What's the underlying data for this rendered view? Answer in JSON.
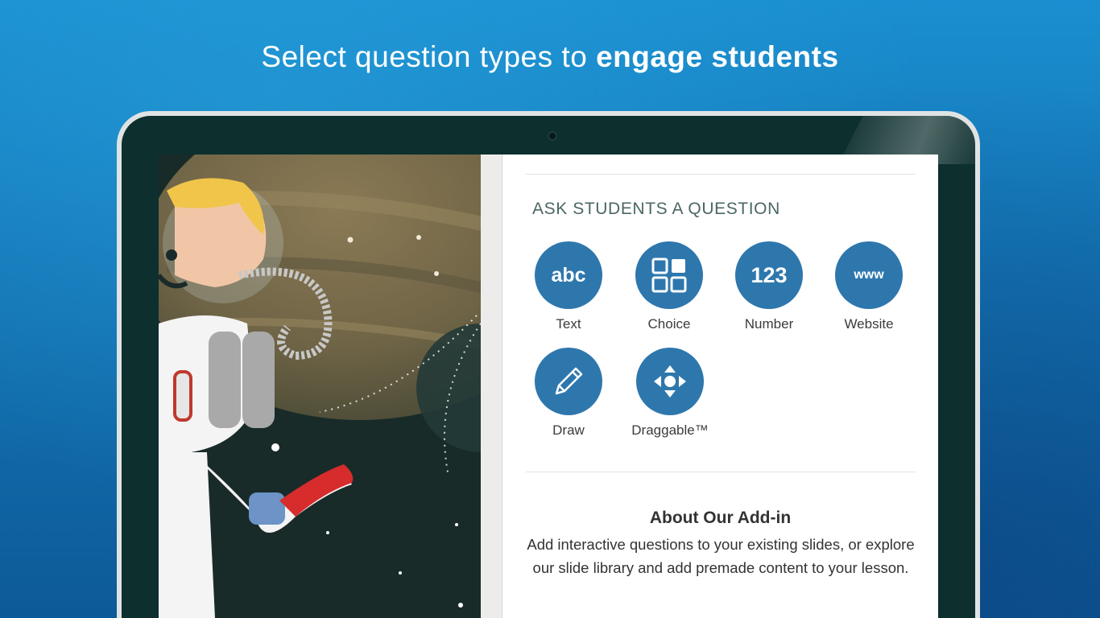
{
  "headline": {
    "regular": "Select question types to ",
    "bold": "engage students"
  },
  "panel": {
    "section_title": "ASK STUDENTS A QUESTION",
    "question_types": [
      {
        "label": "Text",
        "icon": "abc-text-icon",
        "glyph": "abc"
      },
      {
        "label": "Choice",
        "icon": "choice-grid-icon",
        "glyph": ""
      },
      {
        "label": "Number",
        "icon": "number-icon",
        "glyph": "123"
      },
      {
        "label": "Website",
        "icon": "website-www-icon",
        "glyph": "www"
      },
      {
        "label": "Draw",
        "icon": "pencil-icon",
        "glyph": ""
      },
      {
        "label": "Draggable™",
        "icon": "draggable-arrows-icon",
        "glyph": ""
      }
    ],
    "about": {
      "title": "About Our Add-in",
      "text": "Add interactive questions to your existing slides, or explore our slide library and add premade content to your lesson."
    }
  },
  "colors": {
    "background": "#1474b4",
    "bezel": "#0d2f2e",
    "icon_circle": "#2e77ad",
    "section_title": "#4b6764"
  }
}
